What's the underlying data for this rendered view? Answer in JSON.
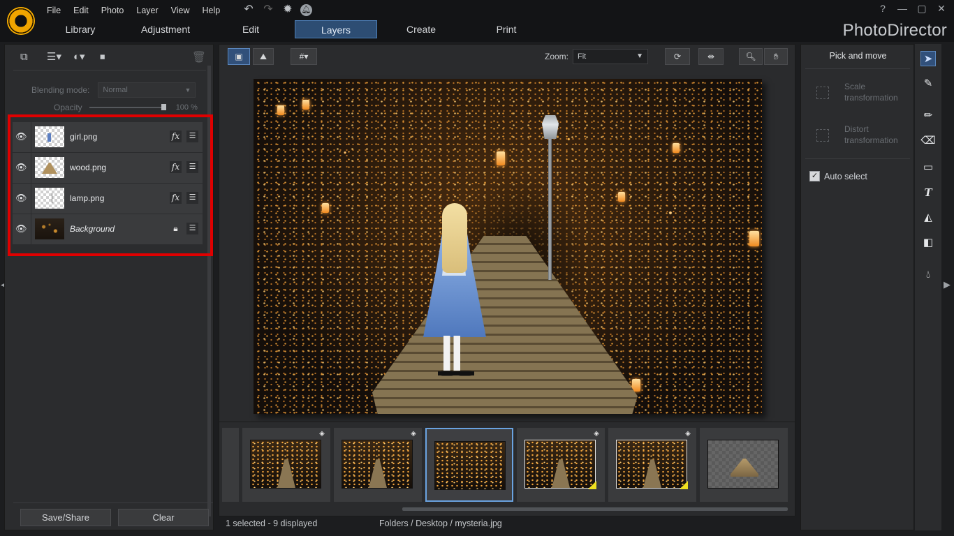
{
  "app": {
    "brand": "PhotoDirector",
    "menu": [
      "File",
      "Edit",
      "Photo",
      "Layer",
      "View",
      "Help"
    ],
    "toolbar_icons": [
      "undo-icon",
      "redo-icon",
      "settings-icon",
      "notification-icon"
    ],
    "window_controls": [
      "?",
      "—",
      "▢",
      "✕"
    ],
    "tabs": [
      {
        "label": "Library"
      },
      {
        "label": "Adjustment"
      },
      {
        "label": "Edit"
      },
      {
        "label": "Layers",
        "active": true
      },
      {
        "label": "Create"
      },
      {
        "label": "Print"
      }
    ]
  },
  "layers_panel": {
    "tools": [
      "add-layer-icon",
      "layer-options-icon",
      "mask-options-icon",
      "stop-icon",
      "trash-icon"
    ],
    "blending_mode_label": "Blending mode:",
    "blending_mode_value": "Normal",
    "opacity_label": "Opacity",
    "opacity_value": "100 %",
    "opacity": 1.0,
    "highlight_color": "#e00000",
    "layers": [
      {
        "name": "girl.png",
        "visible": true,
        "has_fx": true,
        "locked": false
      },
      {
        "name": "wood.png",
        "visible": true,
        "has_fx": true,
        "locked": false
      },
      {
        "name": "lamp.png",
        "visible": true,
        "has_fx": true,
        "locked": false
      },
      {
        "name": "Background",
        "visible": true,
        "has_fx": false,
        "locked": true
      }
    ],
    "save_share_label": "Save/Share",
    "clear_label": "Clear"
  },
  "viewer": {
    "zoom_label": "Zoom:",
    "zoom_value": "Fit",
    "accent_color": "#31507a"
  },
  "filmstrip": {
    "items": [
      {
        "kind": "photo-girl",
        "has_layers_badge": true,
        "flagged": false,
        "selected": false
      },
      {
        "kind": "photo-girl",
        "has_layers_badge": true,
        "flagged": false,
        "selected": false
      },
      {
        "kind": "photo-bg",
        "has_layers_badge": false,
        "flagged": false,
        "selected": true
      },
      {
        "kind": "photo-girl",
        "has_layers_badge": true,
        "flagged": true,
        "selected": false
      },
      {
        "kind": "photo-girl",
        "has_layers_badge": true,
        "flagged": true,
        "selected": false
      },
      {
        "kind": "wood-transparent",
        "has_layers_badge": false,
        "flagged": false,
        "selected": false
      }
    ]
  },
  "status": {
    "selection": "1 selected - 9 displayed",
    "path": "Folders / Desktop / mysteria.jpg"
  },
  "right_panel": {
    "title": "Pick and move",
    "scale_label_1": "Scale",
    "scale_label_2": "transformation",
    "distort_label_1": "Distort",
    "distort_label_2": "transformation",
    "auto_select_label": "Auto select",
    "auto_select_checked": true
  },
  "tool_strip": [
    "pointer-icon",
    "brush-select-icon",
    "pencil-icon",
    "eraser-icon",
    "rectangle-icon",
    "text-icon",
    "fill-bucket-icon",
    "gradient-icon",
    "droplet-icon"
  ]
}
